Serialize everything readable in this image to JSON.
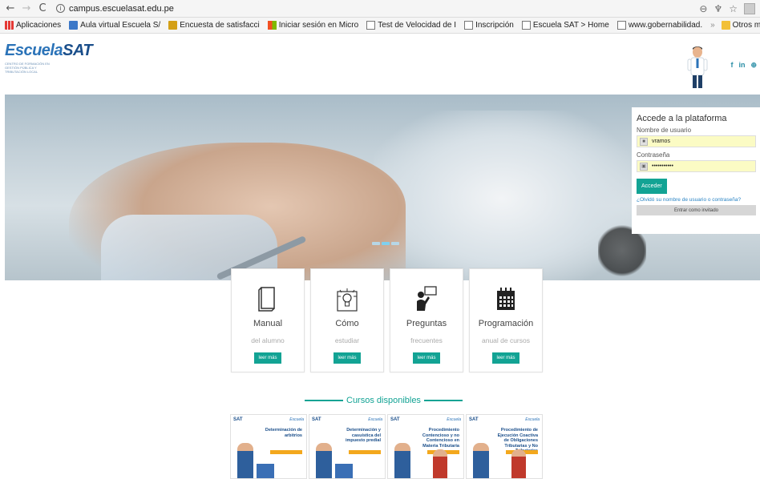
{
  "browser": {
    "url": "campus.escuelasat.edu.pe",
    "bookmarks": [
      {
        "label": "Aplicaciones",
        "icon": "apps-icon"
      },
      {
        "label": "Aula virtual Escuela S/",
        "icon": "book-icon"
      },
      {
        "label": "Encuesta de satisfacci",
        "icon": "m-icon"
      },
      {
        "label": "Iniciar sesión en Micro",
        "icon": "microsoft-icon"
      },
      {
        "label": "Test de Velocidad de I",
        "icon": "page-icon"
      },
      {
        "label": "Inscripción",
        "icon": "page-icon"
      },
      {
        "label": "Escuela SAT > Home",
        "icon": "page-icon"
      },
      {
        "label": "www.gobernabilidad.",
        "icon": "page-icon"
      }
    ],
    "more": "»",
    "other_bookmarks": "Otros marcad"
  },
  "site": {
    "logo_text": "Escuela",
    "logo_text_bold": "SAT",
    "logo_subtitle": "CENTRO DE FORMACIÓN EN GESTIÓN PÚBLICA Y TRIBUTACIÓN LOCAL",
    "social": [
      "f",
      "in",
      "⊕"
    ]
  },
  "login": {
    "title": "Accede a la plataforma",
    "username_label": "Nombre de usuario",
    "username_value": "vramos",
    "password_label": "Contraseña",
    "password_value": "•••••••••••",
    "submit": "Acceder",
    "forgot": "¿Olvidó su nombre de usuario o contraseña?",
    "guest": "Entrar como invitado"
  },
  "cards": [
    {
      "title": "Manual",
      "subtitle": "del alumno",
      "button": "leer más",
      "icon": "book-icon"
    },
    {
      "title": "Cómo",
      "subtitle": "estudiar",
      "button": "leer más",
      "icon": "lightbulb-icon"
    },
    {
      "title": "Preguntas",
      "subtitle": "frecuentes",
      "button": "leer más",
      "icon": "teacher-icon"
    },
    {
      "title": "Programación",
      "subtitle": "anual de cursos",
      "button": "leer más",
      "icon": "calendar-icon"
    }
  ],
  "courses_title": "Cursos disponibles",
  "courses": [
    {
      "brand": "SAT",
      "title": "Determinación de arbitrios"
    },
    {
      "brand": "SAT",
      "title": "Determinación y casuística del impuesto predial"
    },
    {
      "brand": "SAT",
      "title": "Procedimiento Contencioso y no Contencioso en Materia Tributaria"
    },
    {
      "brand": "SAT",
      "title": "Procedimiento de Ejecución Coactiva de Obligaciones Tributarias y No Tributarias"
    }
  ],
  "colors": {
    "accent": "#12a394",
    "brand": "#2b73b8",
    "link": "#2a84c4"
  }
}
